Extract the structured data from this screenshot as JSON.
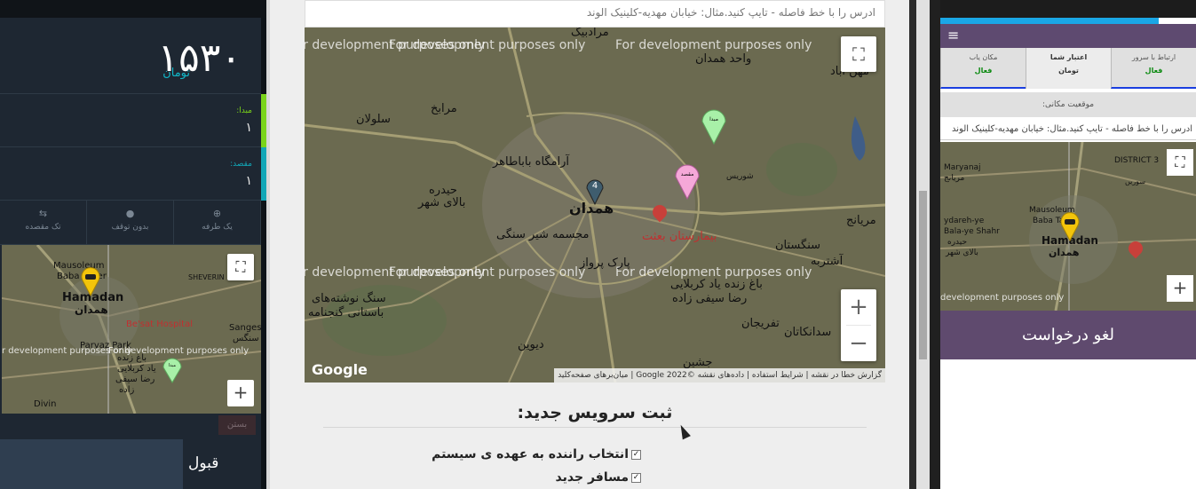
{
  "left_panel": {
    "price_value": "۱۵۳۰",
    "price_unit": "تومان",
    "origin_label": "مبدا:",
    "origin_value": "۱",
    "destination_label": "مقصد:",
    "destination_value": "۱",
    "options": [
      "تک مقصده",
      "بدون توقف",
      "یک طرفه"
    ],
    "map": {
      "labels": [
        "Mausoleum",
        "Baba Taher",
        "Hamadan",
        "همدان",
        "SHEVERIN",
        "Be'sat Hospital",
        "Sanges",
        "سنگس",
        "Parvaz Park",
        "باغ زنده",
        "یاد کربلایی",
        "رضا سیفی",
        "زاده",
        "Divin"
      ],
      "dev_text": "r development purposes only",
      "marker_origin": "مبدا",
      "fullscreen_icon": "⛶",
      "zoom_in": "+"
    },
    "close_label": "بستن",
    "accept_label": "قبول"
  },
  "center_panel": {
    "address_placeholder": "ادرس را با خط فاصله - تایپ کنید.مثال: خیابان مهدیه-کلینیک الوند",
    "map": {
      "dev_text": "For development purposes only",
      "places": [
        "مرادبیگ",
        "واحد همدان",
        "مرابخ",
        "سلولان",
        "همدان",
        "آرامگاه باباطاهر",
        "حیدره",
        "بالای شهر",
        "مجسمه شیر سنگی",
        "بیمارستان بعثت",
        "سنگستان",
        "شوریس",
        "پارک پرواز",
        "باغ زنده یاد کربلایی",
        "رضا سیفی زاده",
        "سنگ نوشته‌های",
        "باستانی گنجنامه",
        "تفریجان",
        "سدانکاتان",
        "دیوین",
        "جشین",
        "آشتربه",
        "مهن آباد",
        "مریانج"
      ],
      "marker_origin": "مبدا",
      "marker_destination": "مقصد",
      "cluster_count": "4",
      "google_logo": "Google",
      "attribution": "گزارش خطا در نقشه | شرایط استفاده | داده‌های نقشه ©2022 Google | میان‌برهای صفحه‌کلید",
      "zoom_in": "+",
      "zoom_out": "−",
      "fullscreen_icon": "⛶"
    },
    "section_title": "ثبت سرویس جدید:",
    "checkbox_auto_driver": "انتخاب راننده به عهده ی سیستم",
    "checkbox_new_passenger": "مسافر جدید",
    "checkbox_auto_driver_checked": "✓",
    "checkbox_new_passenger_checked": "✓"
  },
  "right_panel": {
    "menu_icon": "≡",
    "tabs": [
      {
        "label": "ارتباط با سرور",
        "status": "فعال"
      },
      {
        "label": "اعتبار شما",
        "status": "تومان"
      },
      {
        "label": "مکان یاب",
        "status": "فعال"
      }
    ],
    "location_label": "موقعیت مکانی:",
    "address_text": "ادرس را با خط فاصله - تایپ کنید.مثال: خیابان مهدیه-کلینیک الوند",
    "map": {
      "labels": [
        "Maryanaj",
        "مریانج",
        "DISTRICT 3",
        "سوریں",
        "ydareh-ye",
        "Bala-ye Shahr",
        "حیدره",
        "بالای شهر",
        "Hamadan",
        "همدان",
        "Mausoleum",
        "Baba Taher"
      ],
      "dev_text": "development purposes only",
      "fullscreen_icon": "⛶",
      "zoom_in": "+"
    },
    "cancel_label": "لغو درخواست"
  },
  "colors": {
    "left_bg": "#1e2732",
    "price_unit": "#11b7c8",
    "origin_bar": "#7ad41a",
    "destination_bar": "#12a7b7",
    "map_bg": "#6b6a50",
    "purple": "#5e4a70",
    "progress": "#1aa7e6",
    "status_green": "#0b8a10"
  }
}
